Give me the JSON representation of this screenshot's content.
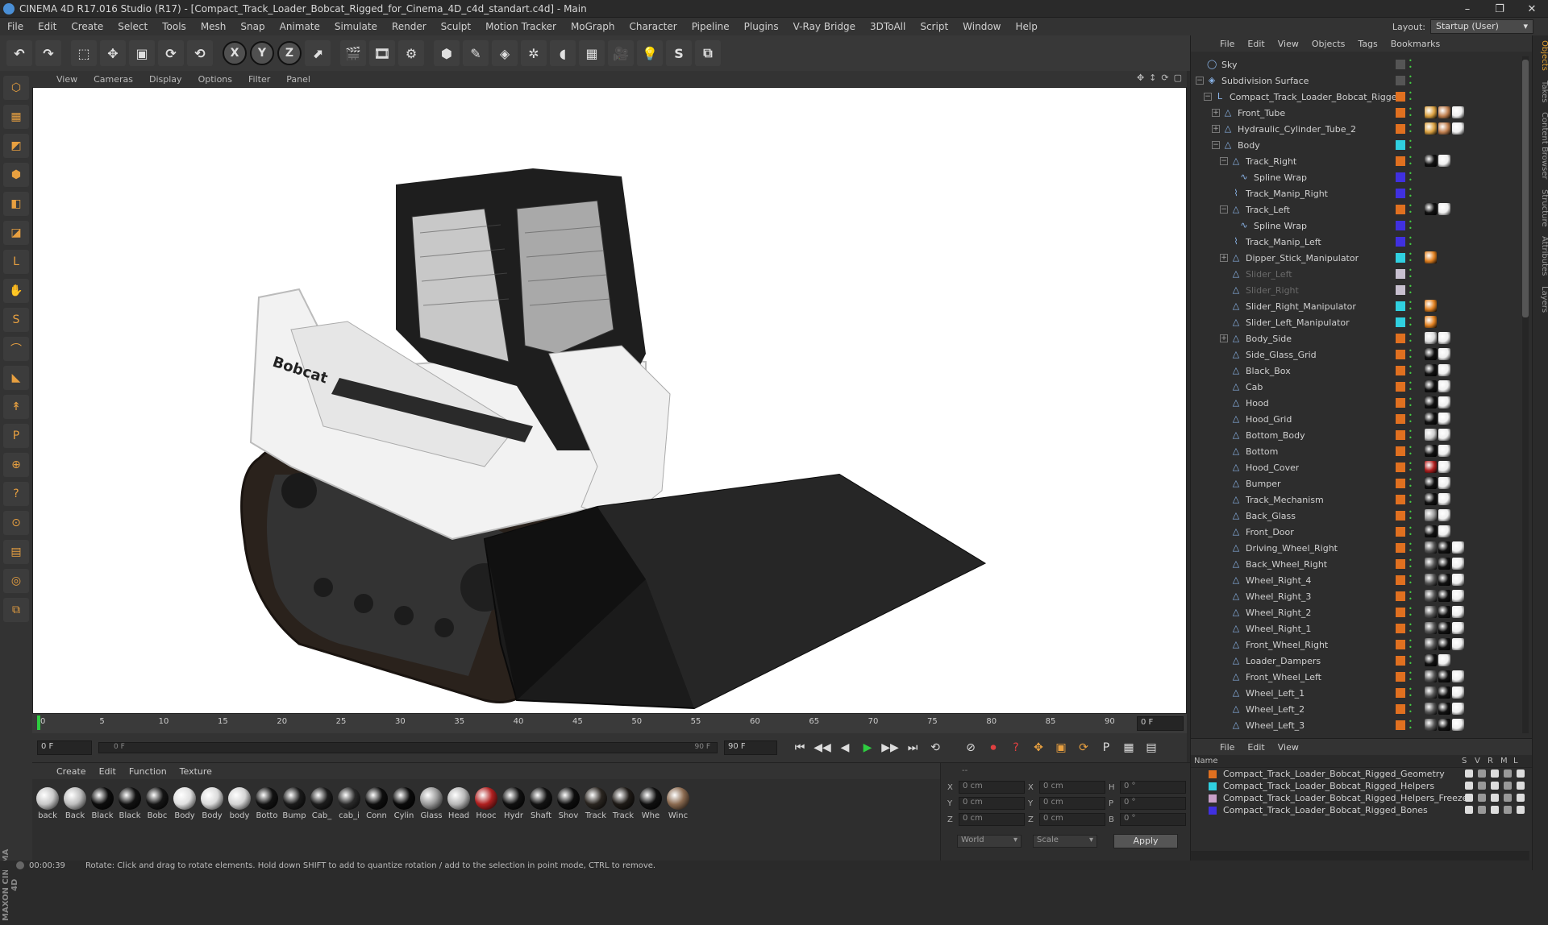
{
  "window": {
    "title": "CINEMA 4D R17.016 Studio (R17) - [Compact_Track_Loader_Bobcat_Rigged_for_Cinema_4D_c4d_standart.c4d] - Main",
    "controls": [
      "–",
      "❐",
      "✕"
    ]
  },
  "menubar": {
    "items": [
      "File",
      "Edit",
      "Create",
      "Select",
      "Tools",
      "Mesh",
      "Snap",
      "Animate",
      "Simulate",
      "Render",
      "Sculpt",
      "Motion Tracker",
      "MoGraph",
      "Character",
      "Pipeline",
      "Plugins",
      "V-Ray Bridge",
      "3DToAll",
      "Script",
      "Window",
      "Help"
    ],
    "layout_label": "Layout:",
    "layout_value": "Startup (User)"
  },
  "toolbar": {
    "buttons": [
      {
        "name": "undo",
        "glyph": "↶"
      },
      {
        "name": "redo",
        "glyph": "↷"
      },
      {
        "name": "live-select",
        "glyph": "⬚"
      },
      {
        "name": "move",
        "glyph": "✥"
      },
      {
        "name": "scale",
        "glyph": "▣"
      },
      {
        "name": "rotate",
        "glyph": "⟳"
      },
      {
        "name": "recent-tool",
        "glyph": "⟲"
      },
      {
        "name": "x-axis",
        "glyph": "X"
      },
      {
        "name": "y-axis",
        "glyph": "Y"
      },
      {
        "name": "z-axis",
        "glyph": "Z"
      },
      {
        "name": "coord-system",
        "glyph": "⬈"
      },
      {
        "name": "render-view",
        "glyph": "🎬"
      },
      {
        "name": "render-picture",
        "glyph": "🎞"
      },
      {
        "name": "render-settings",
        "glyph": "⚙"
      },
      {
        "name": "cube",
        "glyph": "⬢"
      },
      {
        "name": "pen",
        "glyph": "✎"
      },
      {
        "name": "subdivision",
        "glyph": "◈"
      },
      {
        "name": "array",
        "glyph": "✲"
      },
      {
        "name": "deformer",
        "glyph": "◖"
      },
      {
        "name": "floor",
        "glyph": "▦"
      },
      {
        "name": "camera",
        "glyph": "🎥"
      },
      {
        "name": "light",
        "glyph": "💡"
      },
      {
        "name": "script",
        "glyph": "S"
      },
      {
        "name": "python",
        "glyph": "⧉"
      }
    ]
  },
  "left_tools": [
    "⬡",
    "▦",
    "◩",
    "⬢",
    "◧",
    "◪",
    "L",
    "✋",
    "S",
    "⌒",
    "◣",
    "↟",
    "P",
    "⊕",
    "?",
    "⊙",
    "▤",
    "◎",
    "⧉"
  ],
  "left_brand": "MAXON CINEMA 4D",
  "viewport": {
    "menu": [
      "View",
      "Cameras",
      "Display",
      "Options",
      "Filter",
      "Panel"
    ],
    "nav_icons": [
      "✥",
      "↕",
      "⟳",
      "▢"
    ],
    "decal_text": "Bobcat"
  },
  "timeline": {
    "ticks": [
      "0",
      "5",
      "10",
      "15",
      "20",
      "25",
      "30",
      "35",
      "40",
      "45",
      "50",
      "55",
      "60",
      "65",
      "70",
      "75",
      "80",
      "85",
      "90"
    ],
    "end_field": "0 F"
  },
  "playbar": {
    "start_field": "0 F",
    "range_start": "0 F",
    "range_end": "90 F",
    "end_field": "90 F",
    "buttons": [
      "⏮",
      "◀◀",
      "◀",
      "▶",
      "▶▶",
      "⏭",
      "⟲"
    ],
    "key_buttons": [
      "⊘",
      "⏺",
      "?",
      "✥",
      "▣",
      "⟳",
      "P",
      "▦",
      "▤"
    ]
  },
  "materials": {
    "menu": [
      "Create",
      "Edit",
      "Function",
      "Texture"
    ],
    "items": [
      {
        "label": "back",
        "color": "#c8c8c8"
      },
      {
        "label": "Back",
        "color": "#bdbdbd"
      },
      {
        "label": "Black",
        "color": "#0c0c0c"
      },
      {
        "label": "Black",
        "color": "#111"
      },
      {
        "label": "Bobc",
        "color": "#151515"
      },
      {
        "label": "Body",
        "color": "#e0e0e0"
      },
      {
        "label": "Body",
        "color": "#dadada"
      },
      {
        "label": "body",
        "color": "#d4d4d4"
      },
      {
        "label": "Botto",
        "color": "#121212"
      },
      {
        "label": "Bump",
        "color": "#1a1a1a"
      },
      {
        "label": "Cab_",
        "color": "#1c1c1c"
      },
      {
        "label": "cab_i",
        "color": "#2a2a2a"
      },
      {
        "label": "Conn",
        "color": "#0e0e0e"
      },
      {
        "label": "Cylin",
        "color": "#0a0a0a"
      },
      {
        "label": "Glass",
        "color": "#9a9a9a"
      },
      {
        "label": "Head",
        "color": "#b8b8b8"
      },
      {
        "label": "Hooc",
        "color": "#b02020"
      },
      {
        "label": "Hydr",
        "color": "#101010"
      },
      {
        "label": "Shaft",
        "color": "#121212"
      },
      {
        "label": "Shov",
        "color": "#0d0d0d"
      },
      {
        "label": "Track",
        "color": "#2a2520"
      },
      {
        "label": "Track",
        "color": "#1e1a16"
      },
      {
        "label": "Whe",
        "color": "#0f0f0f"
      },
      {
        "label": "Winc",
        "color": "#8a6a50"
      }
    ]
  },
  "coords": {
    "rows": [
      {
        "a": "X",
        "av": "0 cm",
        "b": "X",
        "bv": "0 cm",
        "c": "H",
        "cv": "0 °"
      },
      {
        "a": "Y",
        "av": "0 cm",
        "b": "Y",
        "bv": "0 cm",
        "c": "P",
        "cv": "0 °"
      },
      {
        "a": "Z",
        "av": "0 cm",
        "b": "Z",
        "bv": "0 cm",
        "c": "B",
        "cv": "0 °"
      }
    ],
    "header": "--",
    "space": "World",
    "mode": "Scale",
    "apply": "Apply"
  },
  "status": {
    "time": "00:00:39",
    "message": "Rotate: Click and drag to rotate elements. Hold down SHIFT to add to quantize rotation / add to the selection in point mode, CTRL to remove."
  },
  "objects": {
    "menu": [
      "File",
      "Edit",
      "View",
      "Objects",
      "Tags",
      "Bookmarks"
    ],
    "rows": [
      {
        "name": "Sky",
        "depth": 0,
        "exp": "",
        "icon": "◯",
        "layer": "#555",
        "dim": false,
        "tags": []
      },
      {
        "name": "Subdivision Surface",
        "depth": 0,
        "exp": "−",
        "icon": "◈",
        "layer": "#555",
        "dim": false,
        "tags": []
      },
      {
        "name": "Compact_Track_Loader_Bobcat_Rigged",
        "depth": 1,
        "exp": "−",
        "icon": "L",
        "layer": "#e07020",
        "dim": false,
        "tags": []
      },
      {
        "name": "Front_Tube",
        "depth": 2,
        "exp": "+",
        "icon": "△",
        "layer": "#e07020",
        "dim": false,
        "tags": [
          "#d9a040",
          "#c08050",
          "#eee"
        ]
      },
      {
        "name": "Hydraulic_Cylinder_Tube_2",
        "depth": 2,
        "exp": "+",
        "icon": "△",
        "layer": "#e07020",
        "dim": false,
        "tags": [
          "#d9a040",
          "#c08050",
          "#eee"
        ]
      },
      {
        "name": "Body",
        "depth": 2,
        "exp": "−",
        "icon": "△",
        "layer": "#30d0e0",
        "dim": false,
        "tags": []
      },
      {
        "name": "Track_Right",
        "depth": 3,
        "exp": "−",
        "icon": "△",
        "layer": "#e07020",
        "dim": false,
        "tags": [
          "#111",
          "#eee"
        ]
      },
      {
        "name": "Spline Wrap",
        "depth": 4,
        "exp": "",
        "icon": "∿",
        "layer": "#4030e0",
        "dim": false,
        "tags": []
      },
      {
        "name": "Track_Manip_Right",
        "depth": 3,
        "exp": "",
        "icon": "⌇",
        "layer": "#4030e0",
        "dim": false,
        "tags": []
      },
      {
        "name": "Track_Left",
        "depth": 3,
        "exp": "−",
        "icon": "△",
        "layer": "#e07020",
        "dim": false,
        "tags": [
          "#111",
          "#eee"
        ]
      },
      {
        "name": "Spline Wrap",
        "depth": 4,
        "exp": "",
        "icon": "∿",
        "layer": "#4030e0",
        "dim": false,
        "tags": []
      },
      {
        "name": "Track_Manip_Left",
        "depth": 3,
        "exp": "",
        "icon": "⌇",
        "layer": "#4030e0",
        "dim": false,
        "tags": []
      },
      {
        "name": "Dipper_Stick_Manipulator",
        "depth": 3,
        "exp": "+",
        "icon": "△",
        "layer": "#30d0e0",
        "dim": false,
        "tags": [
          "#e08020"
        ]
      },
      {
        "name": "Slider_Left",
        "depth": 3,
        "exp": "",
        "icon": "△",
        "layer": "#c8c0d0",
        "dim": true,
        "tags": []
      },
      {
        "name": "Slider_Right",
        "depth": 3,
        "exp": "",
        "icon": "△",
        "layer": "#c8c0d0",
        "dim": true,
        "tags": []
      },
      {
        "name": "Slider_Right_Manipulator",
        "depth": 3,
        "exp": "",
        "icon": "△",
        "layer": "#30d0e0",
        "dim": false,
        "tags": [
          "#e08020"
        ]
      },
      {
        "name": "Slider_Left_Manipulator",
        "depth": 3,
        "exp": "",
        "icon": "△",
        "layer": "#30d0e0",
        "dim": false,
        "tags": [
          "#e08020"
        ]
      },
      {
        "name": "Body_Side",
        "depth": 3,
        "exp": "+",
        "icon": "△",
        "layer": "#e07020",
        "dim": false,
        "tags": [
          "#ddd",
          "#eee"
        ]
      },
      {
        "name": "Side_Glass_Grid",
        "depth": 3,
        "exp": "",
        "icon": "△",
        "layer": "#e07020",
        "dim": false,
        "tags": [
          "#111",
          "#eee"
        ]
      },
      {
        "name": "Black_Box",
        "depth": 3,
        "exp": "",
        "icon": "△",
        "layer": "#e07020",
        "dim": false,
        "tags": [
          "#111",
          "#eee"
        ]
      },
      {
        "name": "Cab",
        "depth": 3,
        "exp": "",
        "icon": "△",
        "layer": "#e07020",
        "dim": false,
        "tags": [
          "#111",
          "#eee"
        ]
      },
      {
        "name": "Hood",
        "depth": 3,
        "exp": "",
        "icon": "△",
        "layer": "#e07020",
        "dim": false,
        "tags": [
          "#111",
          "#eee"
        ]
      },
      {
        "name": "Hood_Grid",
        "depth": 3,
        "exp": "",
        "icon": "△",
        "layer": "#e07020",
        "dim": false,
        "tags": [
          "#111",
          "#eee"
        ]
      },
      {
        "name": "Bottom_Body",
        "depth": 3,
        "exp": "",
        "icon": "△",
        "layer": "#e07020",
        "dim": false,
        "tags": [
          "#ccc",
          "#eee"
        ]
      },
      {
        "name": "Bottom",
        "depth": 3,
        "exp": "",
        "icon": "△",
        "layer": "#e07020",
        "dim": false,
        "tags": [
          "#111",
          "#eee"
        ]
      },
      {
        "name": "Hood_Cover",
        "depth": 3,
        "exp": "",
        "icon": "△",
        "layer": "#e07020",
        "dim": false,
        "tags": [
          "#b02020",
          "#eee"
        ]
      },
      {
        "name": "Bumper",
        "depth": 3,
        "exp": "",
        "icon": "△",
        "layer": "#e07020",
        "dim": false,
        "tags": [
          "#111",
          "#eee"
        ]
      },
      {
        "name": "Track_Mechanism",
        "depth": 3,
        "exp": "",
        "icon": "△",
        "layer": "#e07020",
        "dim": false,
        "tags": [
          "#111",
          "#eee"
        ]
      },
      {
        "name": "Back_Glass",
        "depth": 3,
        "exp": "",
        "icon": "△",
        "layer": "#e07020",
        "dim": false,
        "tags": [
          "#999",
          "#eee"
        ]
      },
      {
        "name": "Front_Door",
        "depth": 3,
        "exp": "",
        "icon": "△",
        "layer": "#e07020",
        "dim": false,
        "tags": [
          "#111",
          "#eee"
        ]
      },
      {
        "name": "Driving_Wheel_Right",
        "depth": 3,
        "exp": "",
        "icon": "△",
        "layer": "#e07020",
        "dim": false,
        "tags": [
          "#555",
          "#111",
          "#eee"
        ]
      },
      {
        "name": "Back_Wheel_Right",
        "depth": 3,
        "exp": "",
        "icon": "△",
        "layer": "#e07020",
        "dim": false,
        "tags": [
          "#555",
          "#111",
          "#eee"
        ]
      },
      {
        "name": "Wheel_Right_4",
        "depth": 3,
        "exp": "",
        "icon": "△",
        "layer": "#e07020",
        "dim": false,
        "tags": [
          "#555",
          "#111",
          "#eee"
        ]
      },
      {
        "name": "Wheel_Right_3",
        "depth": 3,
        "exp": "",
        "icon": "△",
        "layer": "#e07020",
        "dim": false,
        "tags": [
          "#555",
          "#111",
          "#eee"
        ]
      },
      {
        "name": "Wheel_Right_2",
        "depth": 3,
        "exp": "",
        "icon": "△",
        "layer": "#e07020",
        "dim": false,
        "tags": [
          "#555",
          "#111",
          "#eee"
        ]
      },
      {
        "name": "Wheel_Right_1",
        "depth": 3,
        "exp": "",
        "icon": "△",
        "layer": "#e07020",
        "dim": false,
        "tags": [
          "#555",
          "#111",
          "#eee"
        ]
      },
      {
        "name": "Front_Wheel_Right",
        "depth": 3,
        "exp": "",
        "icon": "△",
        "layer": "#e07020",
        "dim": false,
        "tags": [
          "#555",
          "#111",
          "#eee"
        ]
      },
      {
        "name": "Loader_Dampers",
        "depth": 3,
        "exp": "",
        "icon": "△",
        "layer": "#e07020",
        "dim": false,
        "tags": [
          "#111",
          "#eee"
        ]
      },
      {
        "name": "Front_Wheel_Left",
        "depth": 3,
        "exp": "",
        "icon": "△",
        "layer": "#e07020",
        "dim": false,
        "tags": [
          "#555",
          "#111",
          "#eee"
        ]
      },
      {
        "name": "Wheel_Left_1",
        "depth": 3,
        "exp": "",
        "icon": "△",
        "layer": "#e07020",
        "dim": false,
        "tags": [
          "#555",
          "#111",
          "#eee"
        ]
      },
      {
        "name": "Wheel_Left_2",
        "depth": 3,
        "exp": "",
        "icon": "△",
        "layer": "#e07020",
        "dim": false,
        "tags": [
          "#555",
          "#111",
          "#eee"
        ]
      },
      {
        "name": "Wheel_Left_3",
        "depth": 3,
        "exp": "",
        "icon": "△",
        "layer": "#e07020",
        "dim": false,
        "tags": [
          "#555",
          "#111",
          "#eee"
        ]
      }
    ]
  },
  "layers": {
    "menu": [
      "File",
      "Edit",
      "View"
    ],
    "header": {
      "name": "Name",
      "s": "S",
      "v": "V",
      "r": "R",
      "m": "M",
      "l": "L"
    },
    "rows": [
      {
        "name": "Compact_Track_Loader_Bobcat_Rigged_Geometry",
        "color": "#e07020"
      },
      {
        "name": "Compact_Track_Loader_Bobcat_Rigged_Helpers",
        "color": "#30d0e0"
      },
      {
        "name": "Compact_Track_Loader_Bobcat_Rigged_Helpers_Freeze",
        "color": "#c8a0c8"
      },
      {
        "name": "Compact_Track_Loader_Bobcat_Rigged_Bones",
        "color": "#4030e0"
      }
    ]
  },
  "right_tabs": [
    "Objects",
    "Takes",
    "Content Browser",
    "Structure",
    "Attributes",
    "Layers"
  ]
}
